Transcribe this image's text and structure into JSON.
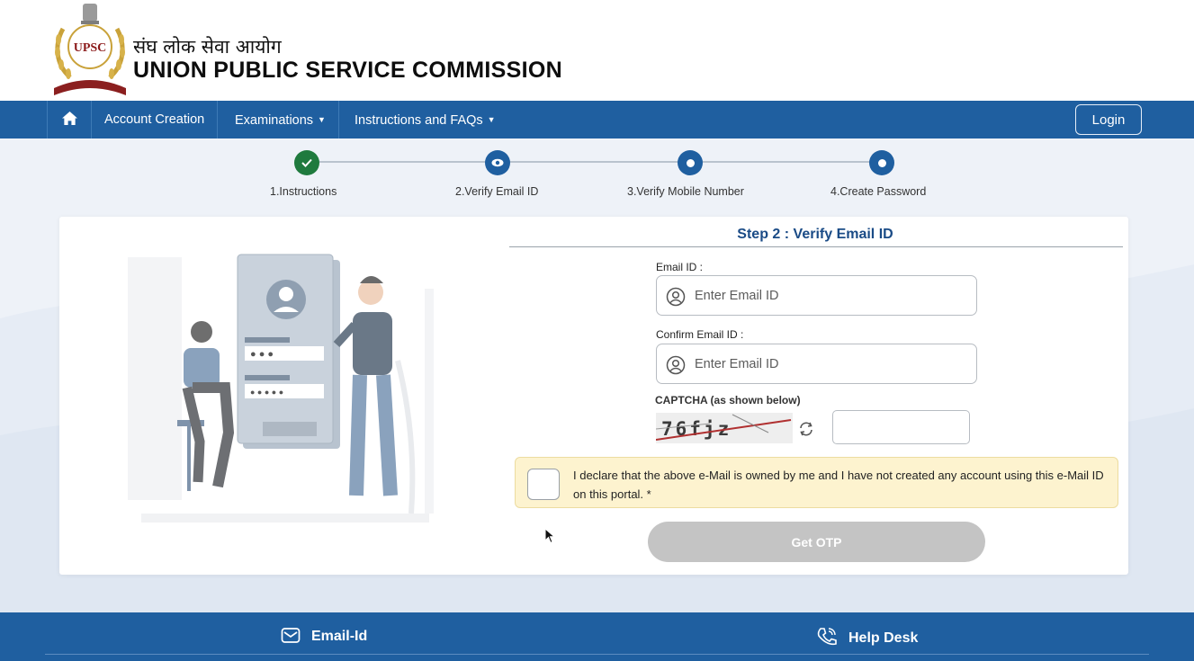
{
  "header": {
    "emblem_text": "UPSC",
    "title_hindi": "संघ लोक सेवा आयोग",
    "title_english": "UNION PUBLIC SERVICE COMMISSION"
  },
  "nav": {
    "home_icon": "home-icon",
    "items": [
      {
        "label": "Account Creation",
        "has_dropdown": false
      },
      {
        "label": "Examinations",
        "has_dropdown": true
      },
      {
        "label": "Instructions and FAQs",
        "has_dropdown": true
      }
    ],
    "login_label": "Login"
  },
  "stepper": {
    "steps": [
      {
        "label": "1.Instructions",
        "state": "done"
      },
      {
        "label": "2.Verify Email ID",
        "state": "active"
      },
      {
        "label": "3.Verify Mobile Number",
        "state": "pending"
      },
      {
        "label": "4.Create Password",
        "state": "pending"
      }
    ]
  },
  "form": {
    "title": "Step 2 : Verify Email ID",
    "email_label": "Email ID :",
    "email_placeholder": "Enter Email ID",
    "email_value": "",
    "confirm_label": "Confirm Email ID :",
    "confirm_placeholder": "Enter Email ID",
    "confirm_value": "",
    "captcha_label": "CAPTCHA (as shown below)",
    "captcha_text": "76fjz",
    "captcha_value": "",
    "declaration": "I declare that the above e-Mail is owned by me and I have not created any account using this e-Mail ID on this portal. *",
    "declaration_checked": false,
    "submit_label": "Get OTP",
    "submit_enabled": false
  },
  "footer": {
    "email_label": "Email-Id",
    "helpdesk_label": "Help Desk"
  },
  "colors": {
    "primary": "#1f5fa0",
    "done": "#1f7a3e",
    "declaration_bg": "#fdf3cf",
    "disabled_button": "#c4c4c4"
  }
}
